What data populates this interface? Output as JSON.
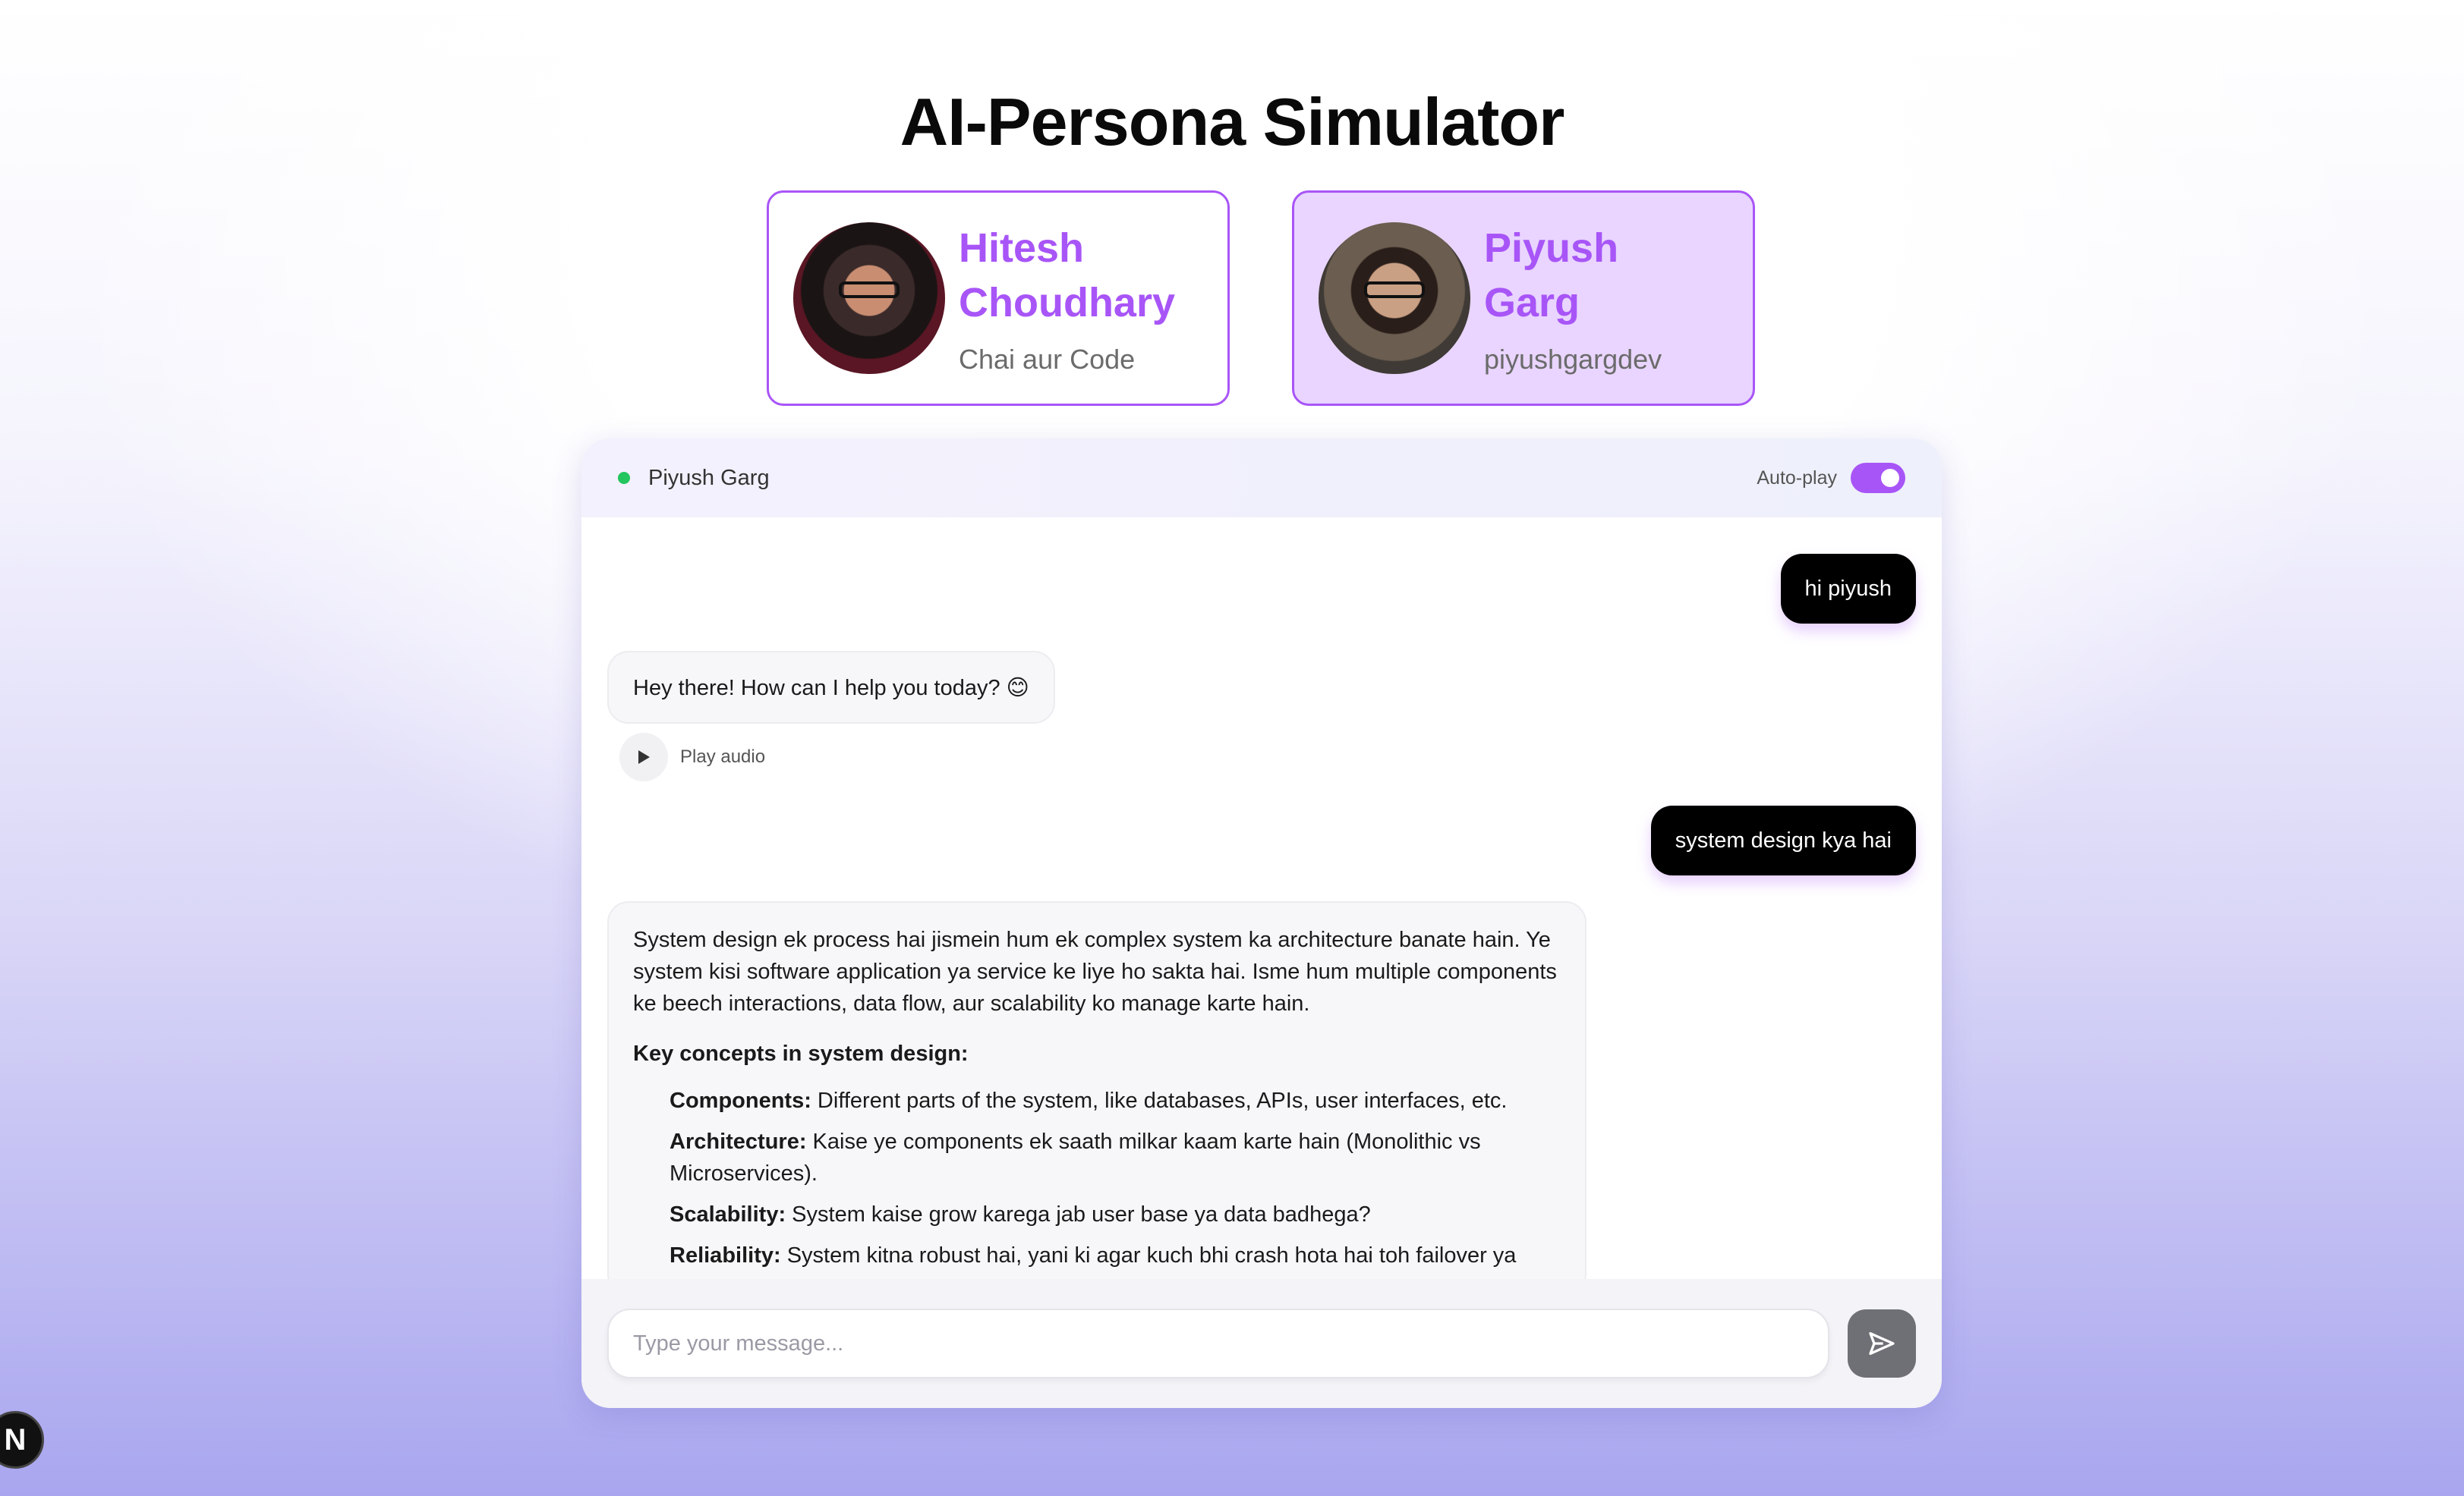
{
  "page": {
    "title": "AI-Persona Simulator"
  },
  "personas": [
    {
      "name": "Hitesh Choudhary",
      "name_line1": "Hitesh",
      "name_line2": "Choudhary",
      "handle": "Chai aur Code",
      "selected": false
    },
    {
      "name": "Piyush Garg",
      "name_line1": "Piyush",
      "name_line2": "Garg",
      "handle": "piyushgargdev",
      "selected": true
    }
  ],
  "chat": {
    "active_persona": "Piyush Garg",
    "autoplay_label": "Auto-play",
    "autoplay_enabled": true,
    "messages": [
      {
        "role": "user",
        "text": "hi piyush"
      },
      {
        "role": "bot",
        "text": "Hey there! How can I help you today? 😊",
        "play_label": "Play audio"
      },
      {
        "role": "user",
        "text": "system design kya hai"
      },
      {
        "role": "bot",
        "intro": "System design ek process hai jismein hum ek complex system ka architecture banate hain. Ye system kisi software application ya service ke liye ho sakta hai. Isme hum multiple components ke beech interactions, data flow, aur scalability ko manage karte hain.",
        "heading": "Key concepts in system design:",
        "concepts": [
          {
            "term": "Components:",
            "desc": " Different parts of the system, like databases, APIs, user interfaces, etc."
          },
          {
            "term": "Architecture:",
            "desc": " Kaise ye components ek saath milkar kaam karte hain (Monolithic vs Microservices)."
          },
          {
            "term": "Scalability:",
            "desc": " System kaise grow karega jab user base ya data badhega?"
          },
          {
            "term": "Reliability:",
            "desc": " System kitna robust hai, yani ki agar kuch bhi crash hota hai toh failover ya"
          }
        ]
      }
    ],
    "input_placeholder": "Type your message..."
  },
  "icons": {
    "play": "play-icon",
    "send": "send-icon",
    "status": "online-dot",
    "framework_badge": "N"
  },
  "colors": {
    "accent": "#a855f7",
    "online": "#22c55e",
    "user_bubble": "#000000"
  }
}
